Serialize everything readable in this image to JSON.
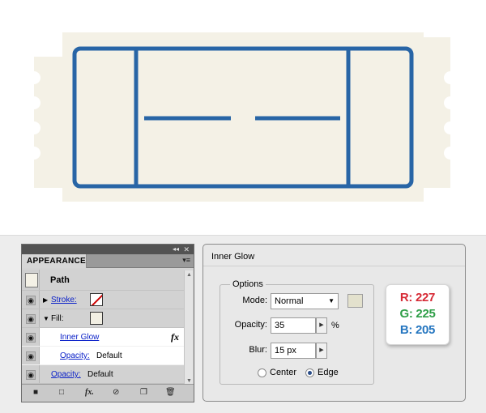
{
  "appearance_panel": {
    "tab_label": "APPEARANCE",
    "path_label": "Path",
    "stroke_label": "Stroke:",
    "fill_label": "Fill:",
    "inner_glow_label": "Inner Glow",
    "fill_opacity_label": "Opacity:",
    "fill_opacity_value": "Default",
    "path_opacity_label": "Opacity:",
    "path_opacity_value": "Default",
    "fx_icon_glyph": "fx",
    "bottom_fx_glyph": "fx."
  },
  "inner_glow_dialog": {
    "title": "Inner Glow",
    "options_legend": "Options",
    "mode_label": "Mode:",
    "mode_value": "Normal",
    "opacity_label": "Opacity:",
    "opacity_value": "35",
    "opacity_unit": "%",
    "blur_label": "Blur:",
    "blur_value": "15 px",
    "center_label": "Center",
    "edge_label": "Edge",
    "selected_source": "Edge",
    "glow_color": "#E3E1CD"
  },
  "rgb_card": {
    "r_text": "R: 227",
    "g_text": "G: 225",
    "b_text": "B: 205",
    "r_color": "#D62A35",
    "g_color": "#2E9E47",
    "b_color": "#2576C0"
  },
  "ticket": {
    "fill_color": "#F4F1E6",
    "stroke_color": "#2865A6"
  }
}
